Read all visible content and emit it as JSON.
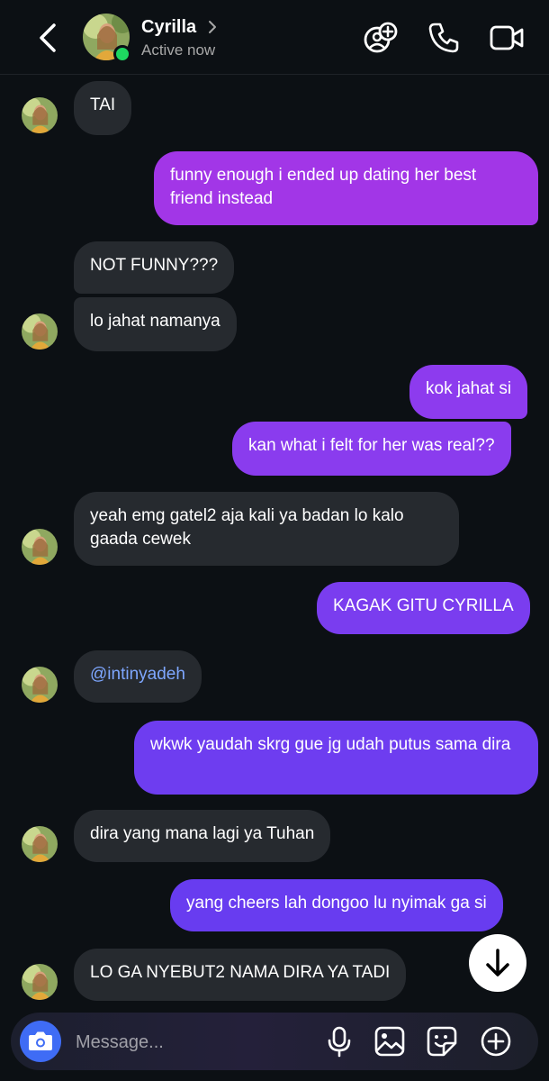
{
  "header": {
    "name": "Cyrilla",
    "status": "Active now",
    "icons": [
      "back-icon",
      "chevron-right-icon",
      "add-people-icon",
      "phone-icon",
      "video-icon"
    ]
  },
  "messages": [
    {
      "from": "them",
      "text": "TAI"
    },
    {
      "from": "me",
      "text": "funny enough i ended up dating her best friend instead"
    },
    {
      "from": "them",
      "text": "NOT FUNNY???"
    },
    {
      "from": "them",
      "text": "lo jahat namanya"
    },
    {
      "from": "me",
      "text": "kok jahat si"
    },
    {
      "from": "me",
      "text": "kan what i felt for her was real??"
    },
    {
      "from": "them",
      "text": "yeah emg gatel2 aja kali ya badan lo kalo gaada cewek"
    },
    {
      "from": "me",
      "text": "KAGAK GITU CYRILLA"
    },
    {
      "from": "them",
      "text": "@intinyadeh"
    },
    {
      "from": "me",
      "text": "wkwk yaudah skrg gue jg udah putus sama dira"
    },
    {
      "from": "them",
      "text": "dira yang mana lagi ya Tuhan"
    },
    {
      "from": "me",
      "text": "yang cheers lah dongoo lu nyimak ga si"
    },
    {
      "from": "them",
      "text": "LO GA NYEBUT2 NAMA DIRA YA TADI"
    }
  ],
  "composer": {
    "placeholder": "Message...",
    "icons": [
      "camera-icon",
      "microphone-icon",
      "gallery-icon",
      "sticker-icon",
      "plus-icon"
    ]
  },
  "colors": {
    "background": "#0c1014",
    "incoming_bubble": "#262a2f",
    "outgoing_top": "#a533e6",
    "outgoing_bottom": "#6a3cf0",
    "camera_button": "#3f6cf5",
    "online": "#1ed760",
    "mention": "#7ea7ff"
  }
}
